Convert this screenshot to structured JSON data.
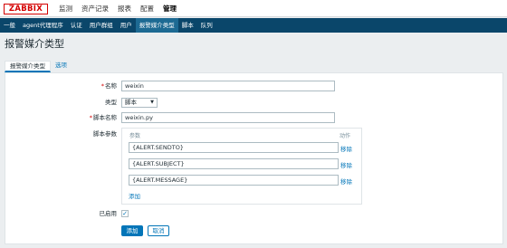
{
  "logo": "ZABBIX",
  "main_nav": [
    "监测",
    "资产记录",
    "报表",
    "配置",
    "管理"
  ],
  "sub_nav": [
    "一般",
    "agent代理程序",
    "认证",
    "用户群组",
    "用户",
    "报警媒介类型",
    "脚本",
    "队列"
  ],
  "page_title": "报警媒介类型",
  "tabs": [
    "报警媒介类型",
    "选项"
  ],
  "form": {
    "name_label": "名称",
    "name_value": "weixin",
    "type_label": "类型",
    "type_value": "脚本",
    "script_name_label": "脚本名称",
    "script_name_value": "weixin.py",
    "script_params_label": "脚本参数",
    "params_header": "参数",
    "action_header": "动作",
    "params": [
      {
        "value": "{ALERT.SENDTO}",
        "remove": "移除"
      },
      {
        "value": "{ALERT.SUBJECT}",
        "remove": "移除"
      },
      {
        "value": "{ALERT.MESSAGE}",
        "remove": "移除"
      }
    ],
    "add_param": "添加",
    "enabled_label": "已启用",
    "enabled": true,
    "add_button": "添加",
    "cancel_button": "取消"
  },
  "colors": {
    "brand": "#d40000",
    "subnav_bg": "#0a466a",
    "accent": "#0275b8"
  }
}
